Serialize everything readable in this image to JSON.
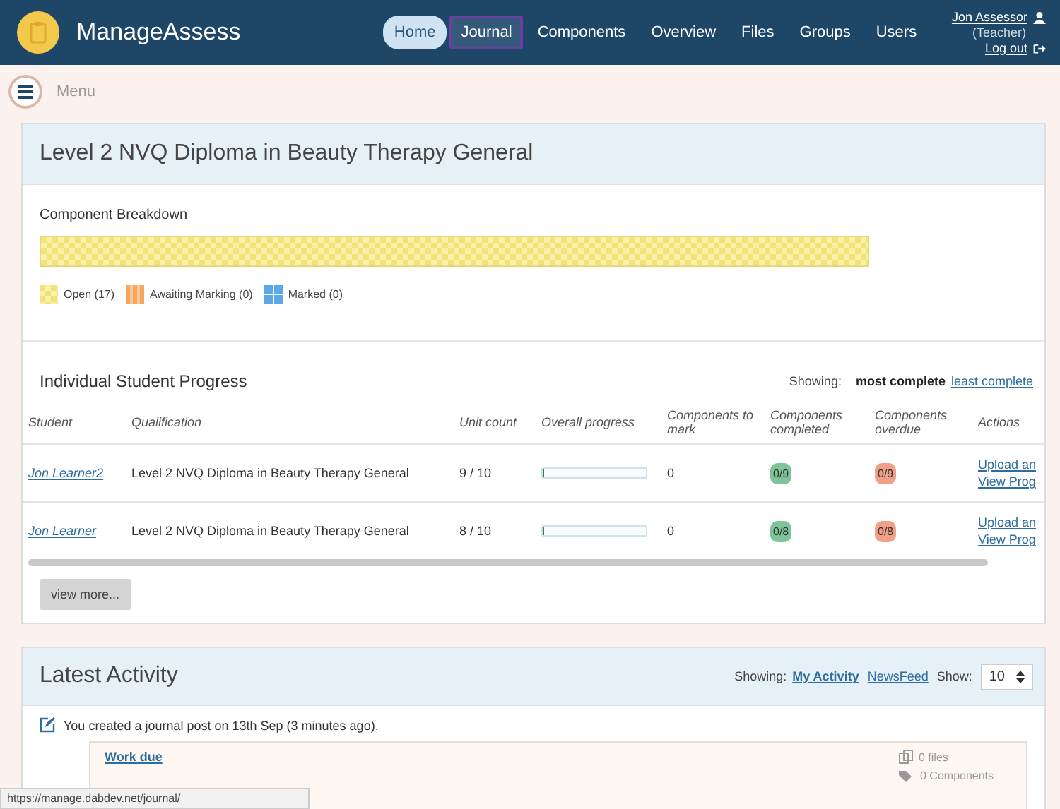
{
  "nav": {
    "brand": "ManageAssess",
    "items": [
      {
        "label": "Home",
        "selected": true,
        "hovered": false
      },
      {
        "label": "Journal",
        "selected": false,
        "hovered": true
      },
      {
        "label": "Components",
        "selected": false,
        "hovered": false
      },
      {
        "label": "Overview",
        "selected": false,
        "hovered": false
      },
      {
        "label": "Files",
        "selected": false,
        "hovered": false
      },
      {
        "label": "Groups",
        "selected": false,
        "hovered": false
      },
      {
        "label": "Users",
        "selected": false,
        "hovered": false
      }
    ],
    "user": {
      "name": "Jon Assessor",
      "role": "(Teacher)",
      "logout": "Log out"
    }
  },
  "menu": {
    "label": "Menu"
  },
  "qualification": {
    "title": "Level 2 NVQ Diploma in Beauty Therapy General",
    "breakdown_label": "Component Breakdown",
    "breakdown": [
      {
        "kind": "open",
        "level": 1
      }
    ],
    "legend": [
      {
        "kind": "open",
        "label": "Open (17)"
      },
      {
        "kind": "awaiting",
        "label": "Awaiting Marking (0)"
      },
      {
        "kind": "marked",
        "label": "Marked (0)"
      }
    ]
  },
  "progress": {
    "title": "Individual Student Progress",
    "showing_label": "Showing:",
    "sort_options": [
      {
        "label": "most complete",
        "selected": true
      },
      {
        "label": "least complete",
        "selected": false
      }
    ],
    "columns": [
      "Student",
      "Qualification",
      "Unit count",
      "Overall progress",
      "Components to mark",
      "Components completed",
      "Components overdue",
      "Actions"
    ],
    "rows": [
      {
        "student": "Jon Learner2",
        "qualification": "Level 2 NVQ Diploma in Beauty Therapy General",
        "unit_count": "9 / 10",
        "level": 0.02,
        "to_mark": "0",
        "completed": "0/9",
        "overdue": "0/9",
        "actions": [
          "Upload an",
          "View Prog"
        ]
      },
      {
        "student": "Jon Learner",
        "qualification": "Level 2 NVQ Diploma in Beauty Therapy General",
        "unit_count": "8 / 10",
        "level": 0.02,
        "to_mark": "0",
        "completed": "0/8",
        "overdue": "0/8",
        "actions": [
          "Upload an",
          "View Prog"
        ]
      }
    ],
    "view_more": "view more..."
  },
  "activity": {
    "title": "Latest Activity",
    "showing_label": "Showing:",
    "filters": [
      {
        "label": "My Activity",
        "selected": true
      },
      {
        "label": "NewsFeed",
        "selected": false
      }
    ],
    "show_label": "Show:",
    "show_value": "10",
    "items": [
      {
        "text": "You created a journal post on 13th Sep (3 minutes ago).",
        "post_title": "Work due",
        "files": "0 files",
        "components": "0 Components"
      }
    ]
  },
  "status_url": "https://manage.dabdev.net/journal/"
}
